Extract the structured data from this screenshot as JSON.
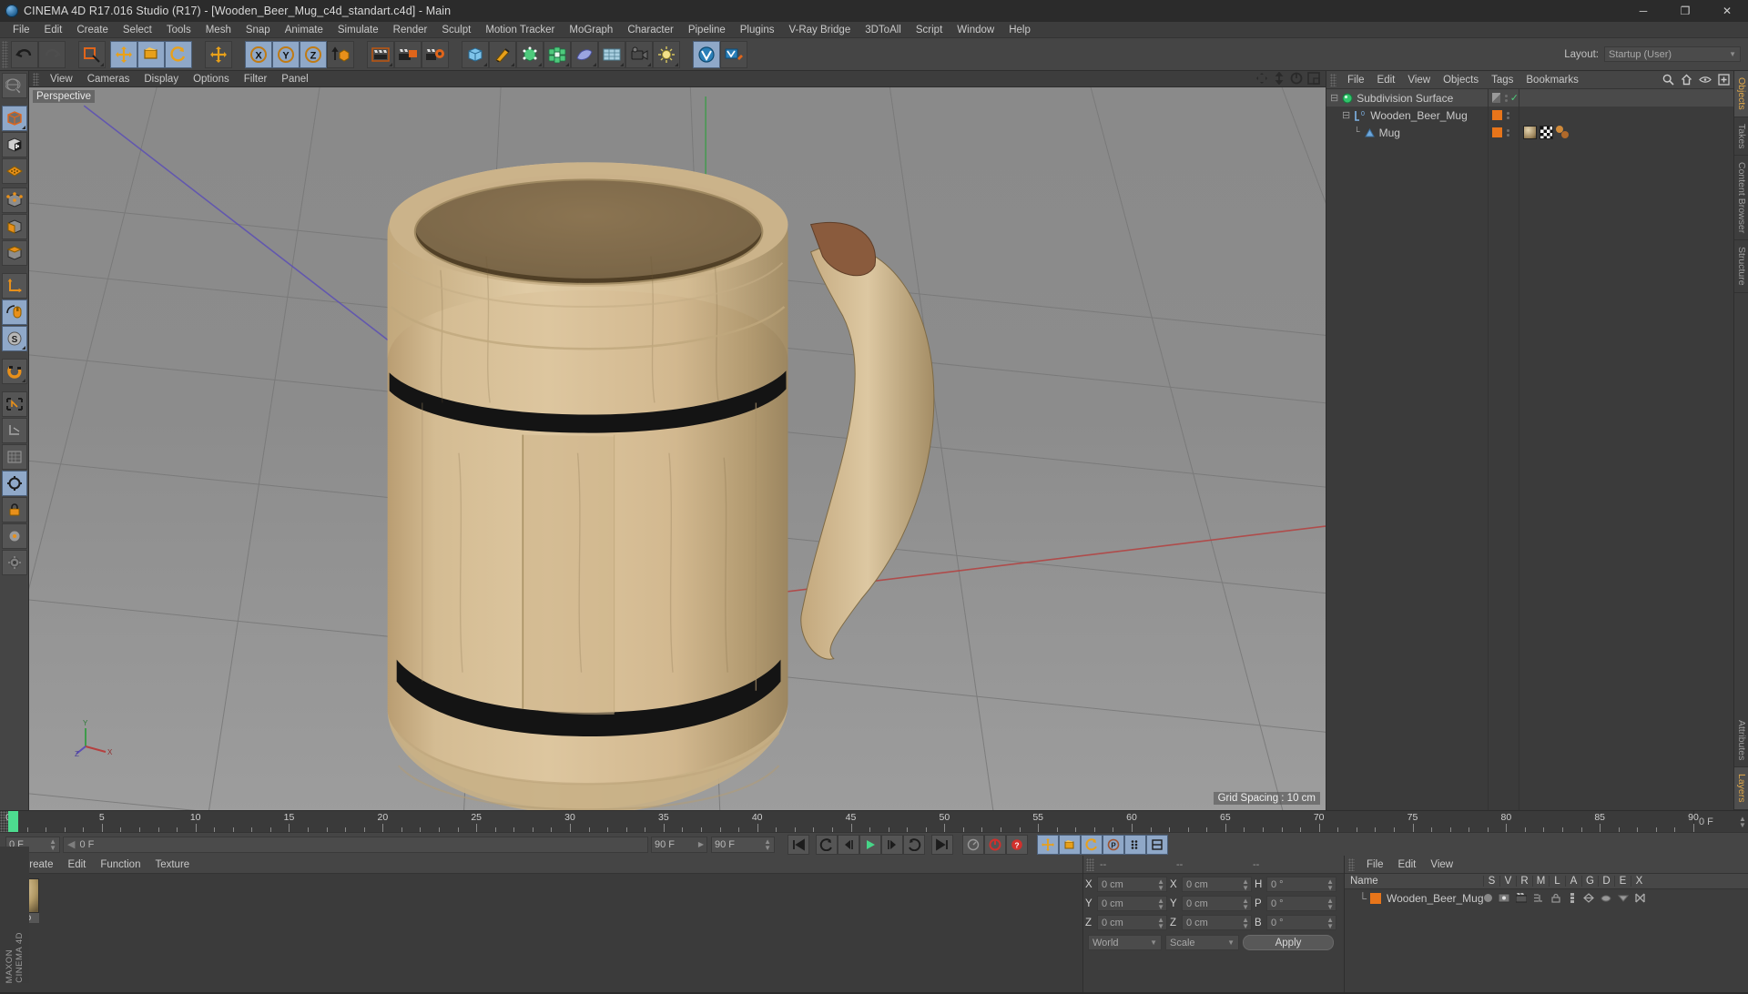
{
  "window": {
    "title": "CINEMA 4D R17.016 Studio (R17) - [Wooden_Beer_Mug_c4d_standart.c4d] - Main",
    "minimize": "─",
    "maximize": "❐",
    "close": "✕"
  },
  "menubar": {
    "items": [
      "File",
      "Edit",
      "Create",
      "Select",
      "Tools",
      "Mesh",
      "Snap",
      "Animate",
      "Simulate",
      "Render",
      "Sculpt",
      "Motion Tracker",
      "MoGraph",
      "Character",
      "Pipeline",
      "Plugins",
      "V-Ray Bridge",
      "3DToAll",
      "Script",
      "Window",
      "Help"
    ]
  },
  "layout": {
    "label": "Layout:",
    "value": "Startup (User)"
  },
  "toolbar": {
    "buttons": [
      {
        "name": "undo-button",
        "icon": "undo",
        "state": "flat"
      },
      {
        "name": "redo-button",
        "icon": "redo",
        "state": "flat"
      },
      {
        "name": "live-selection-button",
        "icon": "live-selection",
        "state": "flat"
      },
      {
        "name": "move-tool-button",
        "icon": "move",
        "state": "on"
      },
      {
        "name": "scale-tool-button",
        "icon": "scale",
        "state": "on"
      },
      {
        "name": "rotate-tool-button",
        "icon": "rotate",
        "state": "on"
      },
      {
        "name": "move-alt-button",
        "icon": "move",
        "state": "flat"
      },
      {
        "name": "x-axis-lock-button",
        "icon": "axis-x",
        "state": "on"
      },
      {
        "name": "y-axis-lock-button",
        "icon": "axis-y",
        "state": "on"
      },
      {
        "name": "z-axis-lock-button",
        "icon": "axis-z",
        "state": "on"
      },
      {
        "name": "world-object-coord-button",
        "icon": "world-coord",
        "state": "flat"
      },
      {
        "name": "render-view-button",
        "icon": "render-view",
        "state": "flat"
      },
      {
        "name": "render-region-button",
        "icon": "render-region",
        "state": "flat"
      },
      {
        "name": "render-settings-button",
        "icon": "render-settings",
        "state": "flat"
      },
      {
        "name": "add-cube-button",
        "icon": "cube",
        "state": "flat"
      },
      {
        "name": "add-spline-button",
        "icon": "pen",
        "state": "flat"
      },
      {
        "name": "add-generator-button",
        "icon": "generator",
        "state": "flat"
      },
      {
        "name": "add-mograph-button",
        "icon": "mograph",
        "state": "flat"
      },
      {
        "name": "add-deformer-button",
        "icon": "deformer",
        "state": "flat"
      },
      {
        "name": "add-scene-button",
        "icon": "scene-grid",
        "state": "flat"
      },
      {
        "name": "add-camera-button",
        "icon": "camera",
        "state": "flat"
      },
      {
        "name": "add-light-button",
        "icon": "light",
        "state": "flat"
      },
      {
        "name": "vray-button",
        "icon": "vray",
        "state": "on"
      },
      {
        "name": "vray-render-button",
        "icon": "vray-render",
        "state": "flat"
      }
    ]
  },
  "lefttoolbar": {
    "buttons": [
      {
        "name": "make-editable-button",
        "icon": "globe-editable",
        "state": "flat"
      },
      {
        "name": "model-mode-button",
        "icon": "model-cube",
        "state": "on"
      },
      {
        "name": "texture-mode-button",
        "icon": "texture-cube",
        "state": "flat"
      },
      {
        "name": "points-mode-button",
        "icon": "points-grid",
        "state": "flat"
      },
      {
        "name": "edges-mode-button",
        "icon": "edges-cube",
        "state": "flat"
      },
      {
        "name": "polygons-mode-button",
        "icon": "polygons-cube",
        "state": "flat"
      },
      {
        "name": "object-axis-button",
        "icon": "axis-cube",
        "state": "flat"
      },
      {
        "name": "world-axis-button",
        "icon": "world-axis",
        "state": "flat"
      },
      {
        "name": "viewport-solo-button",
        "icon": "mouse",
        "state": "on"
      },
      {
        "name": "soft-selection-button",
        "icon": "s-circle",
        "state": "on"
      },
      {
        "name": "snap-button",
        "icon": "magnet",
        "state": "flat"
      },
      {
        "name": "workplane-button",
        "icon": "workplane",
        "state": "flat"
      },
      {
        "name": "lock-axis-button",
        "icon": "lock-axis",
        "state": "flat"
      },
      {
        "name": "quantize-button",
        "icon": "quantize",
        "state": "flat"
      },
      {
        "name": "enable-snap-button",
        "icon": "snap-lock",
        "state": "on"
      },
      {
        "name": "lock-workplane-button",
        "icon": "padlock",
        "state": "flat"
      },
      {
        "name": "planar-button",
        "icon": "planar-wheel",
        "state": "flat"
      },
      {
        "name": "gear-button",
        "icon": "gear-axis",
        "state": "flat"
      }
    ],
    "brand_top": "MAXON",
    "brand_bottom": "CINEMA 4D"
  },
  "viewport": {
    "menu": [
      "View",
      "Cameras",
      "Display",
      "Options",
      "Filter",
      "Panel"
    ],
    "label": "Perspective",
    "grid_spacing": "Grid Spacing : 10 cm",
    "nav_icons": [
      "pan-icon",
      "dolly-icon",
      "orbit-icon",
      "maximize-view-icon"
    ],
    "axis_labels": {
      "y": "Y",
      "x": "X",
      "z": "Z"
    }
  },
  "object_manager": {
    "menu": [
      "File",
      "Edit",
      "View",
      "Objects",
      "Tags",
      "Bookmarks"
    ],
    "header_icons": [
      "search-icon",
      "home-icon",
      "eye-icon",
      "add-layer-icon"
    ],
    "rows": [
      {
        "name": "Subdivision Surface",
        "depth": 0,
        "icon": "subdivision-surface-icon",
        "tag_color": "#7c7c7c",
        "check": "✓"
      },
      {
        "name": "Wooden_Beer_Mug",
        "depth": 1,
        "icon": "null-object-icon",
        "tag_color": "#e8751a",
        "check": ""
      },
      {
        "name": "Mug",
        "depth": 2,
        "icon": "polygon-object-icon",
        "tag_color": "#e8751a",
        "check": "",
        "tags": [
          "material-tag",
          "uvw-tag",
          "texture-tag"
        ]
      }
    ]
  },
  "right_tabs": [
    {
      "label": "Objects",
      "active": true
    },
    {
      "label": "Takes",
      "active": false
    },
    {
      "label": "Content Browser",
      "active": false
    },
    {
      "label": "Structure",
      "active": false
    }
  ],
  "bottom_right_tabs": [
    {
      "label": "Attributes",
      "active": false
    },
    {
      "label": "Layers",
      "active": true
    }
  ],
  "timeline": {
    "ticks": [
      0,
      5,
      10,
      15,
      20,
      25,
      30,
      35,
      40,
      45,
      50,
      55,
      60,
      65,
      70,
      75,
      80,
      85,
      90
    ],
    "current_frame_box": "0 F",
    "start_field": "0 F",
    "scrub_value": "0 F",
    "end_label": "90 F",
    "end_field": "90 F",
    "playhead_frame": 0,
    "controls": [
      {
        "name": "go-to-start-button",
        "icon": "skip-start"
      },
      {
        "name": "previous-keyframe-button",
        "icon": "prev-key"
      },
      {
        "name": "step-back-button",
        "icon": "step-back"
      },
      {
        "name": "play-button",
        "icon": "play"
      },
      {
        "name": "step-forward-button",
        "icon": "step-forward"
      },
      {
        "name": "next-keyframe-button",
        "icon": "next-key"
      },
      {
        "name": "go-to-end-button",
        "icon": "skip-end"
      },
      {
        "name": "autokey-button",
        "icon": "speedometer"
      },
      {
        "name": "record-button",
        "icon": "record"
      },
      {
        "name": "keyframe-selection-button",
        "icon": "key-question"
      },
      {
        "name": "position-key-button",
        "icon": "move-key",
        "state": "on"
      },
      {
        "name": "scale-key-button",
        "icon": "scale-key",
        "state": "on"
      },
      {
        "name": "rotation-key-button",
        "icon": "rotate-key",
        "state": "on"
      },
      {
        "name": "parameter-key-button",
        "icon": "param-key",
        "state": "on"
      },
      {
        "name": "point-level-key-button",
        "icon": "point-key",
        "state": "on"
      },
      {
        "name": "timeline-settings-button",
        "icon": "timeline-settings",
        "state": "on"
      }
    ]
  },
  "materials": {
    "menu": [
      "Create",
      "Edit",
      "Function",
      "Texture"
    ],
    "items": [
      {
        "name": "Woo",
        "icon": "material-sphere"
      }
    ]
  },
  "coordinates": {
    "headers": [
      "--",
      "--",
      "--"
    ],
    "rows": [
      {
        "label1": "X",
        "value1": "0 cm",
        "label2": "X",
        "value2": "0 cm",
        "label3": "H",
        "value3": "0 °"
      },
      {
        "label1": "Y",
        "value1": "0 cm",
        "label2": "Y",
        "value2": "0 cm",
        "label3": "P",
        "value3": "0 °"
      },
      {
        "label1": "Z",
        "value1": "0 cm",
        "label2": "Z",
        "value2": "0 cm",
        "label3": "B",
        "value3": "0 °"
      }
    ],
    "coord_system": "World",
    "transform_mode": "Scale",
    "apply_label": "Apply"
  },
  "layers": {
    "menu": [
      "File",
      "Edit",
      "View"
    ],
    "name_header": "Name",
    "columns": [
      "S",
      "V",
      "R",
      "M",
      "L",
      "A",
      "G",
      "D",
      "E",
      "X"
    ],
    "rows": [
      {
        "name": "Wooden_Beer_Mug",
        "color": "#e8751a"
      }
    ]
  },
  "colors": {
    "accent_orange": "#e8751a",
    "highlight_blue": "#8fa8c8",
    "panel_bg": "#3d3d3d",
    "toolbar_bg": "#454545",
    "titlebar_bg": "#2b2b2b",
    "viewport_bg": "#8d8d8d",
    "playhead_green": "#4ddc8f",
    "tab_active_text": "#e0a84a"
  }
}
